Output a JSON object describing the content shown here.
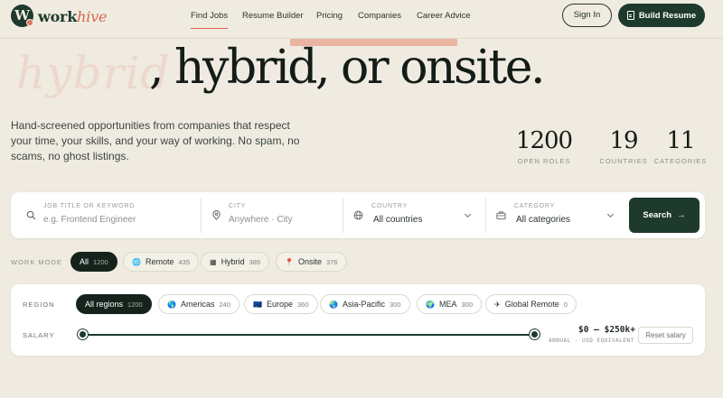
{
  "brand": {
    "mark": "W",
    "name_main": "work",
    "name_accent": "hive",
    "accent_color": "#d9664b",
    "primary_color": "#1e3a2c"
  },
  "nav": {
    "links": [
      {
        "label": "Find Jobs",
        "active": true
      },
      {
        "label": "Resume Builder",
        "active": false
      },
      {
        "label": "Pricing",
        "active": false
      },
      {
        "label": "Companies",
        "active": false
      },
      {
        "label": "Career Advice",
        "active": false
      }
    ],
    "signin_label": "Sign In",
    "build_label": "Build Resume"
  },
  "hero": {
    "ghost_word": "hybrid",
    "title": ", hybrid, or onsite.",
    "subtitle": "Hand-screened opportunities from companies that respect your time, your skills, and your way of working. No spam, no scams, no ghost listings."
  },
  "stats": [
    {
      "value": "1200",
      "label": "OPEN ROLES"
    },
    {
      "value": "19",
      "label": "COUNTRIES"
    },
    {
      "value": "11",
      "label": "CATEGORIES"
    }
  ],
  "search": {
    "keyword": {
      "label": "JOB TITLE OR KEYWORD",
      "placeholder": "e.g. Frontend Engineer"
    },
    "city": {
      "label": "CITY",
      "placeholder": "Anywhere · City"
    },
    "country": {
      "label": "COUNTRY",
      "value": "All countries"
    },
    "category": {
      "label": "CATEGORY",
      "value": "All categories"
    },
    "button_label": "Search"
  },
  "work_mode": {
    "label": "WORK MODE",
    "chips": [
      {
        "icon": "",
        "label": "All",
        "count": "1200",
        "active": true
      },
      {
        "icon": "🌐",
        "label": "Remote",
        "count": "435",
        "active": false
      },
      {
        "icon": "▦",
        "label": "Hybrid",
        "count": "389",
        "active": false
      },
      {
        "icon": "📍",
        "label": "Onsite",
        "count": "376",
        "active": false
      }
    ]
  },
  "region": {
    "label": "REGION",
    "chips": [
      {
        "icon": "",
        "label": "All regions",
        "count": "1200",
        "active": true
      },
      {
        "icon": "🌎",
        "label": "Americas",
        "count": "240",
        "active": false
      },
      {
        "icon": "🇪🇺",
        "label": "Europe",
        "count": "360",
        "active": false
      },
      {
        "icon": "🌏",
        "label": "Asia-Pacific",
        "count": "300",
        "active": false
      },
      {
        "icon": "🌍",
        "label": "MEA",
        "count": "300",
        "active": false
      },
      {
        "icon": "✈",
        "label": "Global Remote",
        "count": "0",
        "active": false
      }
    ]
  },
  "salary": {
    "label": "SALARY",
    "range_text": "$0 — $250k+",
    "note": "ANNUAL · USD EQUIVALENT",
    "reset_label": "Reset salary",
    "min_fraction": 0,
    "max_fraction": 1
  }
}
